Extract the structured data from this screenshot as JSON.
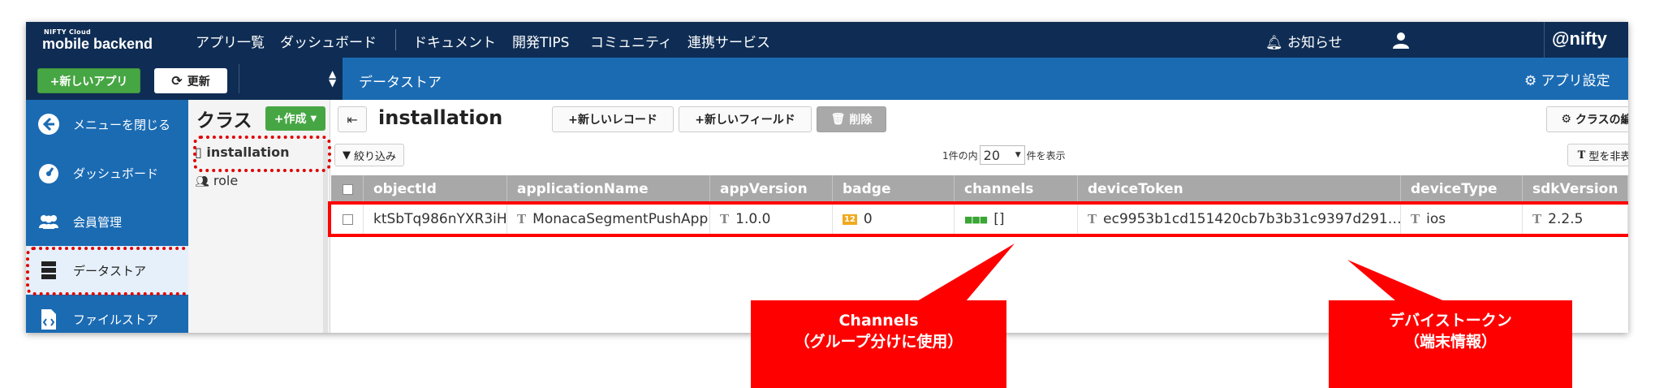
{
  "topnav": {
    "logo_small": "NIFTY Cloud",
    "logo": "mobile backend",
    "items": [
      "アプリ一覧",
      "ダッシュボード",
      "ドキュメント",
      "開発TIPS",
      "コミュニティ",
      "連携サービス"
    ],
    "notify": "お知らせ",
    "brand": "@nifty"
  },
  "subbar": {
    "new_app": "+新しいアプリ",
    "refresh": "更新",
    "section": "データストア",
    "app_settings": "アプリ設定"
  },
  "sidebar": {
    "items": [
      {
        "label": "メニューを閉じる",
        "icon": "arrow-left-circle-icon"
      },
      {
        "label": "ダッシュボード",
        "icon": "gauge-icon"
      },
      {
        "label": "会員管理",
        "icon": "users-icon"
      },
      {
        "label": "データストア",
        "icon": "database-icon"
      },
      {
        "label": "ファイルストア",
        "icon": "file-code-icon"
      }
    ]
  },
  "classes": {
    "title": "クラス",
    "create": "+作成",
    "items": [
      {
        "label": "installation",
        "icon": "mobile-icon"
      },
      {
        "label": "role",
        "icon": "users-icon"
      }
    ]
  },
  "main": {
    "table_name": "installation",
    "new_record": "+新しいレコード",
    "new_field": "+新しいフィールド",
    "delete": "削除",
    "edit_class": "クラスの編集",
    "filter": "絞り込み",
    "paging_prefix": "1件の内",
    "page_size": "20",
    "paging_suffix": "件を表示",
    "type_toggle": "型を非表示",
    "columns": [
      "objectId",
      "applicationName",
      "appVersion",
      "badge",
      "channels",
      "deviceToken",
      "deviceType",
      "sdkVersion"
    ],
    "rows": [
      {
        "objectId": "ktSbTq986nYXR3iH",
        "applicationName": "MonacaSegmentPushApp",
        "appVersion": "1.0.0",
        "badge_icon": "12",
        "badge": "0",
        "channels": "[]",
        "deviceToken": "ec9953b1cd151420cb7b3b31c9397d291…",
        "deviceType": "ios",
        "sdkVersion": "2.2.5"
      }
    ]
  },
  "callouts": {
    "channels_line1": "Channels",
    "channels_line2": "（グループ分けに使用）",
    "token_line1": "デバイストークン",
    "token_line2": "（端末情報）"
  },
  "colors": {
    "nav": "#0f2d54",
    "accent_blue": "#1b6bb3",
    "green": "#47a644",
    "highlight_red": "#ff0000"
  }
}
